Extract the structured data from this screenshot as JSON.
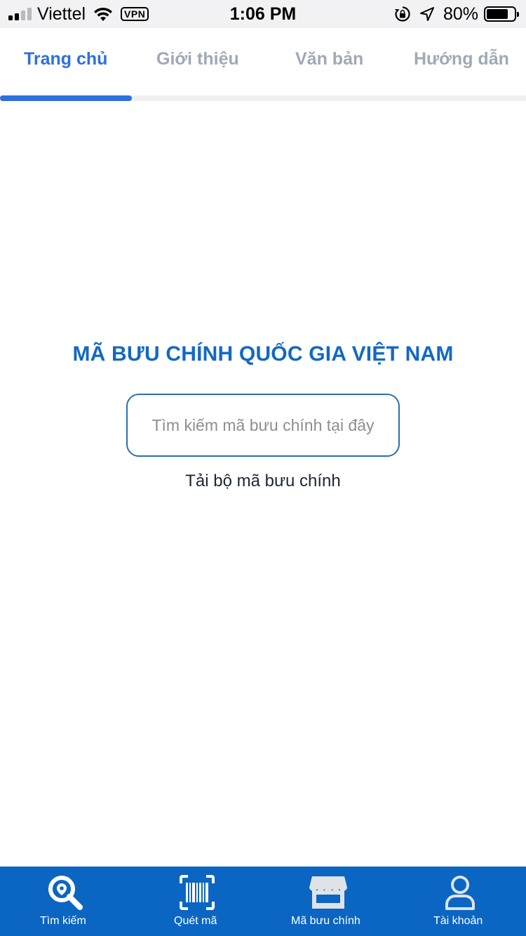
{
  "status_bar": {
    "carrier": "Viettel",
    "vpn": "VPN",
    "time": "1:06 PM",
    "battery": "80%",
    "battery_level": 0.8
  },
  "tabs": [
    {
      "label": "Trang chủ",
      "active": true
    },
    {
      "label": "Giới thiệu",
      "active": false
    },
    {
      "label": "Văn bản",
      "active": false
    },
    {
      "label": "Hướng dẫn",
      "active": false
    }
  ],
  "main": {
    "title": "MÃ BƯU CHÍNH QUỐC GIA VIỆT NAM",
    "search_placeholder": "Tìm kiếm mã bưu chính tại đây",
    "search_value": "",
    "download_link": "Tải bộ mã bưu chính"
  },
  "bottom_nav": [
    {
      "label": "Tìm kiếm",
      "icon": "search-location-icon"
    },
    {
      "label": "Quét mã",
      "icon": "barcode-scan-icon"
    },
    {
      "label": "Mã bưu chính",
      "icon": "storefront-icon"
    },
    {
      "label": "Tài khoản",
      "icon": "user-icon"
    }
  ],
  "colors": {
    "accent": "#2f6fe0",
    "title_blue": "#1368c4",
    "nav_bg": "#0a66c2",
    "tab_inactive": "#a0a9b6"
  }
}
